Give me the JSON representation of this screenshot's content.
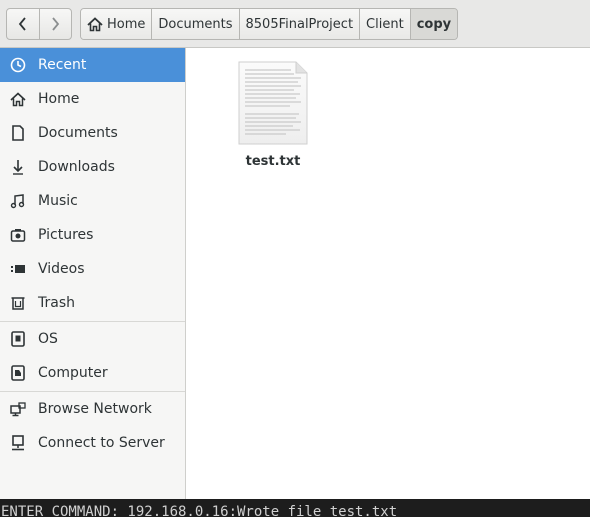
{
  "breadcrumbs": [
    {
      "label": "Home",
      "icon": "home-icon",
      "active": false
    },
    {
      "label": "Documents",
      "active": false
    },
    {
      "label": "8505FinalProject",
      "active": false
    },
    {
      "label": "Client",
      "active": false
    },
    {
      "label": "copy",
      "active": true
    }
  ],
  "sidebar": {
    "accent_color": "#4a90d9",
    "items": [
      {
        "label": "Recent",
        "icon": "clock-icon",
        "active": true
      },
      {
        "label": "Home",
        "icon": "home-icon",
        "active": false
      },
      {
        "label": "Documents",
        "icon": "document-icon",
        "active": false
      },
      {
        "label": "Downloads",
        "icon": "download-icon",
        "active": false
      },
      {
        "label": "Music",
        "icon": "music-icon",
        "active": false
      },
      {
        "label": "Pictures",
        "icon": "camera-icon",
        "active": false
      },
      {
        "label": "Videos",
        "icon": "video-icon",
        "active": false
      },
      {
        "label": "Trash",
        "icon": "trash-icon",
        "active": false
      },
      {
        "label": "OS",
        "icon": "drive-icon",
        "active": false
      },
      {
        "label": "Computer",
        "icon": "computer-drive-icon",
        "active": false
      },
      {
        "label": "Browse Network",
        "icon": "network-icon",
        "active": false
      },
      {
        "label": "Connect to Server",
        "icon": "server-icon",
        "active": false
      }
    ]
  },
  "files": [
    {
      "name": "test.txt",
      "icon": "text-file-icon"
    }
  ],
  "terminal": {
    "text": "ENTER COMMAND: 192.168.0.16:Wrote file test.txt"
  }
}
